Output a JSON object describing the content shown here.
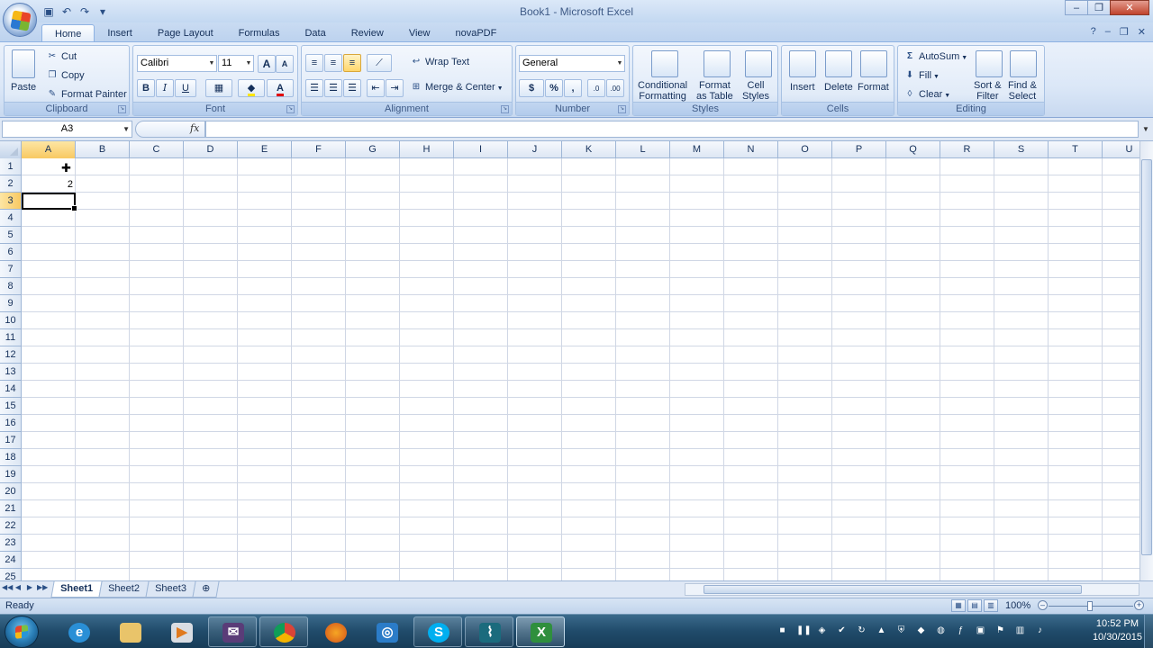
{
  "window": {
    "title": "Book1 - Microsoft Excel",
    "minimize": "–",
    "restore": "❐",
    "close": "✕"
  },
  "qat": {
    "save_icon": "▣",
    "undo_icon": "↶",
    "redo_icon": "↷",
    "customize_icon": "▾"
  },
  "ribbon": {
    "tabs": [
      "Home",
      "Insert",
      "Page Layout",
      "Formulas",
      "Data",
      "Review",
      "View",
      "novaPDF"
    ],
    "active_tab": "Home",
    "help_icon": "?",
    "clipboard": {
      "label": "Clipboard",
      "paste": "Paste",
      "cut": "Cut",
      "copy": "Copy",
      "format_painter": "Format Painter"
    },
    "font": {
      "label": "Font",
      "font_name": "Calibri",
      "font_size": "11",
      "bold": "B",
      "italic": "I",
      "underline": "U",
      "grow": "A",
      "shrink": "A"
    },
    "alignment": {
      "label": "Alignment",
      "wrap_text": "Wrap Text",
      "merge_center": "Merge & Center"
    },
    "number": {
      "label": "Number",
      "format": "General",
      "currency": "$",
      "percent": "%",
      "comma": ","
    },
    "styles": {
      "label": "Styles",
      "conditional_formatting": [
        "Conditional",
        "Formatting"
      ],
      "format_as_table": [
        "Format",
        "as Table"
      ],
      "cell_styles": [
        "Cell",
        "Styles"
      ]
    },
    "cells": {
      "label": "Cells",
      "insert": "Insert",
      "delete": "Delete",
      "format": "Format"
    },
    "editing": {
      "label": "Editing",
      "autosum": "AutoSum",
      "fill": "Fill",
      "clear": "Clear",
      "sort_filter": [
        "Sort &",
        "Filter"
      ],
      "find_select": [
        "Find &",
        "Select"
      ]
    }
  },
  "formula_bar": {
    "name_box": "A3",
    "fx": "fx",
    "formula": ""
  },
  "sheet": {
    "columns": [
      "A",
      "B",
      "C",
      "D",
      "E",
      "F",
      "G",
      "H",
      "I",
      "J",
      "K",
      "L",
      "M",
      "N",
      "O",
      "P",
      "Q",
      "R",
      "S",
      "T",
      "U"
    ],
    "rows": [
      "1",
      "2",
      "3",
      "4",
      "5",
      "6",
      "7",
      "8",
      "9",
      "10",
      "11",
      "12",
      "13",
      "14",
      "15",
      "16",
      "17",
      "18",
      "19",
      "20",
      "21",
      "22",
      "23",
      "24",
      "25"
    ],
    "selected_column": "A",
    "selected_row": "3",
    "cells": {
      "A2": "2"
    },
    "tabs": [
      "Sheet1",
      "Sheet2",
      "Sheet3"
    ],
    "active_tab": "Sheet1"
  },
  "status": {
    "ready": "Ready",
    "zoom": "100%"
  },
  "taskbar": {
    "clock_time": "10:52 PM",
    "clock_date": "10/30/2015"
  }
}
